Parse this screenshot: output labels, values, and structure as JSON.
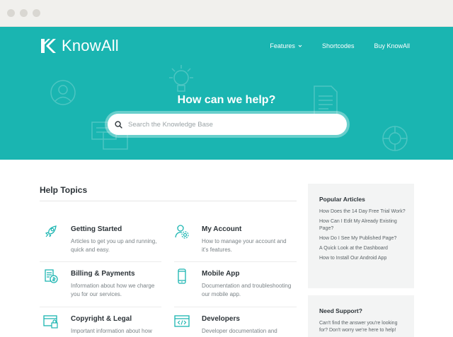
{
  "brand": {
    "name": "KnowAll",
    "accent": "#1ab5b1"
  },
  "nav": {
    "items": [
      "Features",
      "Shortcodes",
      "Buy KnowAll"
    ]
  },
  "hero": {
    "title": "How can we help?",
    "search_placeholder": "Search the Knowledge Base"
  },
  "topics": {
    "heading": "Help Topics",
    "items": [
      {
        "name": "Getting Started",
        "desc": "Articles to get you up and running, quick and easy.",
        "icon": "rocket-icon"
      },
      {
        "name": "My Account",
        "desc": "How to manage your account and it's features.",
        "icon": "user-gear-icon"
      },
      {
        "name": "Billing & Payments",
        "desc": "Information about how we charge you for our services.",
        "icon": "invoice-icon"
      },
      {
        "name": "Mobile App",
        "desc": "Documentation and troubleshooting our mobile app.",
        "icon": "mobile-icon"
      },
      {
        "name": "Copyright & Legal",
        "desc": "Important information about how",
        "icon": "browser-lock-icon"
      },
      {
        "name": "Developers",
        "desc": "Developer documentation and",
        "icon": "code-window-icon"
      }
    ]
  },
  "sidebar": {
    "popular_title": "Popular Articles",
    "popular": [
      "How Does the 14 Day Free Trial Work?",
      "How Can I Edit My Already Existing Page?",
      "How Do I See My Published Page?",
      "A Quick Look at the Dashboard",
      "How to Install Our Android App"
    ],
    "support_title": "Need Support?",
    "support_text": "Can't find the answer you're looking for? Don't worry we're here to help!"
  }
}
